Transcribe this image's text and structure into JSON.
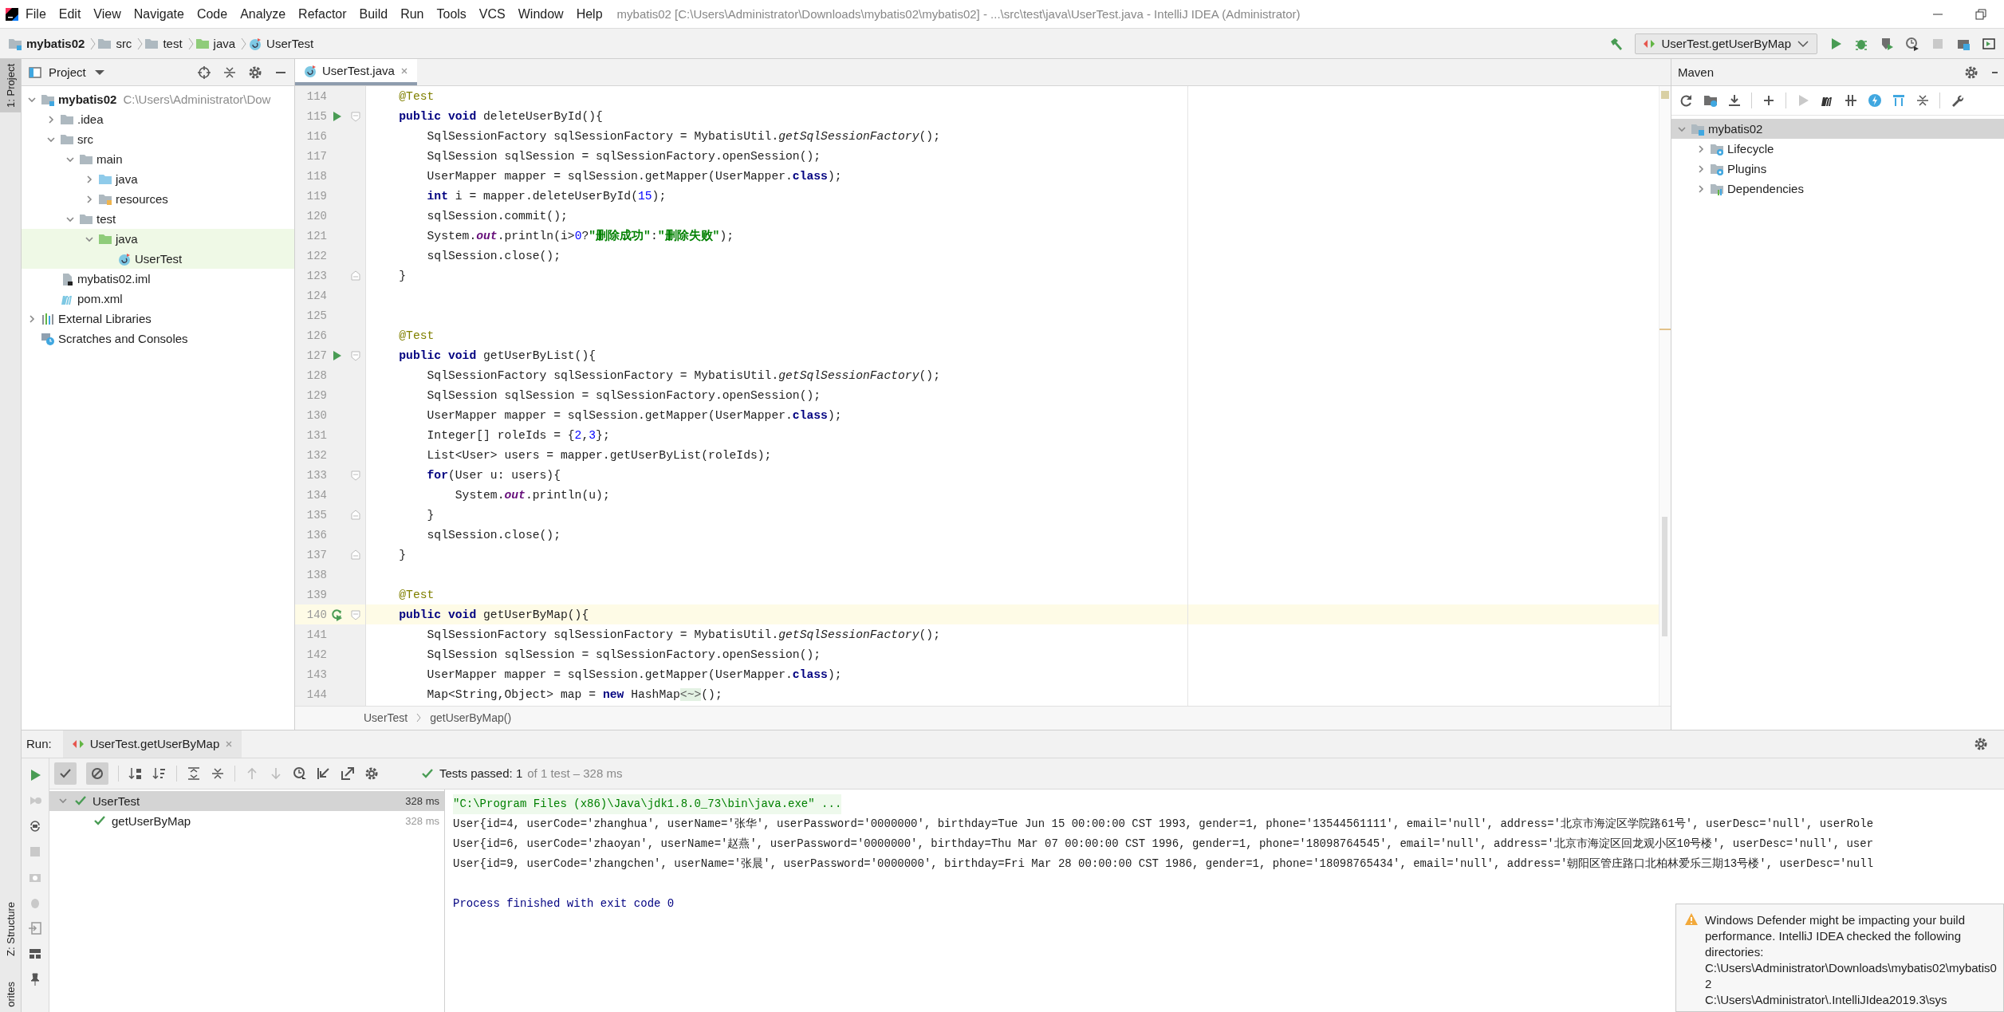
{
  "window": {
    "title": "mybatis02 [C:\\Users\\Administrator\\Downloads\\mybatis02\\mybatis02] - ...\\src\\test\\java\\UserTest.java - IntelliJ IDEA (Administrator)"
  },
  "menu": [
    "File",
    "Edit",
    "View",
    "Navigate",
    "Code",
    "Analyze",
    "Refactor",
    "Build",
    "Run",
    "Tools",
    "VCS",
    "Window",
    "Help"
  ],
  "breadcrumbs": [
    {
      "label": "mybatis02",
      "kind": "module"
    },
    {
      "label": "src",
      "kind": "folder"
    },
    {
      "label": "test",
      "kind": "folder"
    },
    {
      "label": "java",
      "kind": "test-folder"
    },
    {
      "label": "UserTest",
      "kind": "class"
    }
  ],
  "run_config": "UserTest.getUserByMap",
  "tool_strip": {
    "top": "1: Project",
    "bottom": [
      "Z: Structure",
      "orites"
    ]
  },
  "project": {
    "title": "Project",
    "tree": [
      {
        "label": "mybatis02",
        "path": "C:\\Users\\Administrator\\Dow",
        "kind": "module",
        "expanded": true,
        "highlighted": false,
        "children": [
          {
            "label": ".idea",
            "kind": "folder",
            "expanded": false,
            "highlighted": false
          },
          {
            "label": "src",
            "kind": "folder",
            "expanded": true,
            "highlighted": false,
            "children": [
              {
                "label": "main",
                "kind": "folder",
                "expanded": true,
                "highlighted": false,
                "children": [
                  {
                    "label": "java",
                    "kind": "source-folder",
                    "expanded": false,
                    "highlighted": false
                  },
                  {
                    "label": "resources",
                    "kind": "resources",
                    "expanded": false,
                    "highlighted": false
                  }
                ]
              },
              {
                "label": "test",
                "kind": "folder",
                "expanded": true,
                "highlighted": false,
                "children": [
                  {
                    "label": "java",
                    "kind": "test-folder",
                    "expanded": true,
                    "highlighted": true,
                    "children": [
                      {
                        "label": "UserTest",
                        "kind": "class",
                        "highlighted": true
                      }
                    ]
                  }
                ]
              }
            ]
          },
          {
            "label": "mybatis02.iml",
            "kind": "iml",
            "highlighted": false
          },
          {
            "label": "pom.xml",
            "kind": "maven",
            "highlighted": false
          }
        ]
      },
      {
        "label": "External Libraries",
        "kind": "libraries",
        "expanded": false,
        "highlighted": false
      },
      {
        "label": "Scratches and Consoles",
        "kind": "scratches",
        "highlighted": false
      }
    ]
  },
  "editor": {
    "tabs": [
      {
        "label": "UserTest.java",
        "selected": true
      }
    ],
    "lines": [
      {
        "no": "114",
        "current": false,
        "code": [
          {
            "kind": "ann",
            "text": "    @Test"
          }
        ]
      },
      {
        "no": "115",
        "current": false,
        "gutter": {
          "kind": "run"
        },
        "fold": {
          "kind": "start"
        },
        "code": [
          {
            "kind": "kw",
            "text": "    public void"
          },
          {
            "kind": "t",
            "text": " deleteUserById(){"
          }
        ]
      },
      {
        "no": "116",
        "current": false,
        "code": [
          {
            "kind": "t",
            "text": "        SqlSessionFactory sqlSessionFactory = MybatisUtil."
          },
          {
            "kind": "ital",
            "text": "getSqlSessionFactory"
          },
          {
            "kind": "t",
            "text": "();"
          }
        ]
      },
      {
        "no": "117",
        "current": false,
        "code": [
          {
            "kind": "t",
            "text": "        SqlSession sqlSession = sqlSessionFactory.openSession();"
          }
        ]
      },
      {
        "no": "118",
        "current": false,
        "code": [
          {
            "kind": "t",
            "text": "        UserMapper mapper = sqlSession.getMapper(UserMapper."
          },
          {
            "kind": "kw",
            "text": "class"
          },
          {
            "kind": "t",
            "text": ");"
          }
        ]
      },
      {
        "no": "119",
        "current": false,
        "code": [
          {
            "kind": "kw",
            "text": "        int"
          },
          {
            "kind": "t",
            "text": " i = mapper.deleteUserById("
          },
          {
            "kind": "num",
            "text": "15"
          },
          {
            "kind": "t",
            "text": ");"
          }
        ]
      },
      {
        "no": "120",
        "current": false,
        "code": [
          {
            "kind": "t",
            "text": "        sqlSession.commit();"
          }
        ]
      },
      {
        "no": "121",
        "current": false,
        "code": [
          {
            "kind": "t",
            "text": "        System."
          },
          {
            "kind": "fld",
            "text": "out"
          },
          {
            "kind": "t",
            "text": ".println(i>"
          },
          {
            "kind": "num",
            "text": "0"
          },
          {
            "kind": "t",
            "text": "?"
          },
          {
            "kind": "str",
            "text": "\"删除成功\""
          },
          {
            "kind": "t",
            "text": ":"
          },
          {
            "kind": "str",
            "text": "\"删除失败\""
          },
          {
            "kind": "t",
            "text": ");"
          }
        ]
      },
      {
        "no": "122",
        "current": false,
        "code": [
          {
            "kind": "t",
            "text": "        sqlSession.close();"
          }
        ]
      },
      {
        "no": "123",
        "current": false,
        "fold": {
          "kind": "end"
        },
        "code": [
          {
            "kind": "t",
            "text": "    }"
          }
        ]
      },
      {
        "no": "124",
        "current": false
      },
      {
        "no": "125",
        "current": false
      },
      {
        "no": "126",
        "current": false,
        "code": [
          {
            "kind": "ann",
            "text": "    @Test"
          }
        ]
      },
      {
        "no": "127",
        "current": false,
        "gutter": {
          "kind": "run"
        },
        "fold": {
          "kind": "start"
        },
        "code": [
          {
            "kind": "kw",
            "text": "    public void"
          },
          {
            "kind": "t",
            "text": " getUserByList(){"
          }
        ]
      },
      {
        "no": "128",
        "current": false,
        "code": [
          {
            "kind": "t",
            "text": "        SqlSessionFactory sqlSessionFactory = MybatisUtil."
          },
          {
            "kind": "ital",
            "text": "getSqlSessionFactory"
          },
          {
            "kind": "t",
            "text": "();"
          }
        ]
      },
      {
        "no": "129",
        "current": false,
        "code": [
          {
            "kind": "t",
            "text": "        SqlSession sqlSession = sqlSessionFactory.openSession();"
          }
        ]
      },
      {
        "no": "130",
        "current": false,
        "code": [
          {
            "kind": "t",
            "text": "        UserMapper mapper = sqlSession.getMapper(UserMapper."
          },
          {
            "kind": "kw",
            "text": "class"
          },
          {
            "kind": "t",
            "text": ");"
          }
        ]
      },
      {
        "no": "131",
        "current": false,
        "code": [
          {
            "kind": "t",
            "text": "        Integer[] roleIds = {"
          },
          {
            "kind": "num",
            "text": "2"
          },
          {
            "kind": "t",
            "text": ","
          },
          {
            "kind": "num",
            "text": "3"
          },
          {
            "kind": "t",
            "text": "};"
          }
        ]
      },
      {
        "no": "132",
        "current": false,
        "code": [
          {
            "kind": "t",
            "text": "        List<User> users = mapper.getUserByList(roleIds);"
          }
        ]
      },
      {
        "no": "133",
        "current": false,
        "fold": {
          "kind": "start"
        },
        "code": [
          {
            "kind": "kw",
            "text": "        for"
          },
          {
            "kind": "t",
            "text": "(User u: users){"
          }
        ]
      },
      {
        "no": "134",
        "current": false,
        "code": [
          {
            "kind": "t",
            "text": "            System."
          },
          {
            "kind": "fld",
            "text": "out"
          },
          {
            "kind": "t",
            "text": ".println(u);"
          }
        ]
      },
      {
        "no": "135",
        "current": false,
        "fold": {
          "kind": "end"
        },
        "code": [
          {
            "kind": "t",
            "text": "        }"
          }
        ]
      },
      {
        "no": "136",
        "current": false,
        "code": [
          {
            "kind": "t",
            "text": "        sqlSession.close();"
          }
        ]
      },
      {
        "no": "137",
        "current": false,
        "fold": {
          "kind": "end"
        },
        "code": [
          {
            "kind": "t",
            "text": "    }"
          }
        ]
      },
      {
        "no": "138",
        "current": false
      },
      {
        "no": "139",
        "current": false,
        "code": [
          {
            "kind": "ann",
            "text": "    @Test"
          }
        ]
      },
      {
        "no": "140",
        "current": true,
        "gutter": {
          "kind": "rerun"
        },
        "fold": {
          "kind": "start"
        },
        "code": [
          {
            "kind": "kw",
            "text": "    public void"
          },
          {
            "kind": "t",
            "text": " getUserByMap(){"
          }
        ]
      },
      {
        "no": "141",
        "current": false,
        "code": [
          {
            "kind": "t",
            "text": "        SqlSessionFactory sqlSessionFactory = MybatisUtil."
          },
          {
            "kind": "ital",
            "text": "getSqlSessionFactory"
          },
          {
            "kind": "t",
            "text": "();"
          }
        ]
      },
      {
        "no": "142",
        "current": false,
        "code": [
          {
            "kind": "t",
            "text": "        SqlSession sqlSession = sqlSessionFactory.openSession();"
          }
        ]
      },
      {
        "no": "143",
        "current": false,
        "code": [
          {
            "kind": "t",
            "text": "        UserMapper mapper = sqlSession.getMapper(UserMapper."
          },
          {
            "kind": "kw",
            "text": "class"
          },
          {
            "kind": "t",
            "text": ");"
          }
        ]
      },
      {
        "no": "144",
        "current": false,
        "code": [
          {
            "kind": "t",
            "text": "        Map<String,Object> map = "
          },
          {
            "kind": "kw",
            "text": "new"
          },
          {
            "kind": "t",
            "text": " HashMap"
          },
          {
            "kind": "hint",
            "text": "<~>"
          },
          {
            "kind": "t",
            "text": "();"
          }
        ]
      }
    ],
    "breadcrumb": [
      "UserTest",
      "getUserByMap()"
    ]
  },
  "maven": {
    "title": "Maven",
    "tree": [
      {
        "label": "mybatis02",
        "kind": "maven-module",
        "expanded": true,
        "selected": true,
        "children": [
          {
            "label": "Lifecycle",
            "kind": "gear-folder",
            "expanded": false,
            "selected": false
          },
          {
            "label": "Plugins",
            "kind": "gear-folder",
            "expanded": false,
            "selected": false
          },
          {
            "label": "Dependencies",
            "kind": "libraries-folder",
            "expanded": false,
            "selected": false
          }
        ]
      }
    ]
  },
  "run": {
    "label": "Run:",
    "tabs": [
      {
        "label": "UserTest.getUserByMap",
        "selected": true
      }
    ],
    "status": "Tests passed: 1",
    "status_detail": "of 1 test – 328 ms",
    "tests": [
      {
        "label": "UserTest",
        "time": "328 ms",
        "expanded": true,
        "selected": true,
        "children": [
          {
            "label": "getUserByMap",
            "time": "328 ms",
            "selected": false
          }
        ]
      }
    ],
    "console": [
      {
        "kind": "command",
        "text": "\"C:\\Program Files (x86)\\Java\\jdk1.8.0_73\\bin\\java.exe\" ..."
      },
      {
        "kind": "output",
        "text": "User{id=4, userCode='zhanghua', userName='张华', userPassword='0000000', birthday=Tue Jun 15 00:00:00 CST 1993, gender=1, phone='13544561111', email='null', address='北京市海淀区学院路61号', userDesc='null', userRole"
      },
      {
        "kind": "output",
        "text": "User{id=6, userCode='zhaoyan', userName='赵燕', userPassword='0000000', birthday=Thu Mar 07 00:00:00 CST 1996, gender=1, phone='18098764545', email='null', address='北京市海淀区回龙观小区10号楼', userDesc='null', user"
      },
      {
        "kind": "output",
        "text": "User{id=9, userCode='zhangchen', userName='张晨', userPassword='0000000', birthday=Fri Mar 28 00:00:00 CST 1986, gender=1, phone='18098765434', email='null', address='朝阳区管庄路口北柏林爱乐三期13号楼', userDesc='null"
      },
      {
        "kind": "blank"
      },
      {
        "kind": "system",
        "text": "Process finished with exit code 0"
      }
    ]
  },
  "notification": {
    "kind": "warning",
    "message": "Windows Defender might be impacting your build performance. IntelliJ IDEA checked the following directories:",
    "paths": [
      "C:\\Users\\Administrator\\Downloads\\mybatis02\\mybatis02",
      "C:\\Users\\Administrator\\.IntelliJIdea2019.3\\sys"
    ]
  }
}
